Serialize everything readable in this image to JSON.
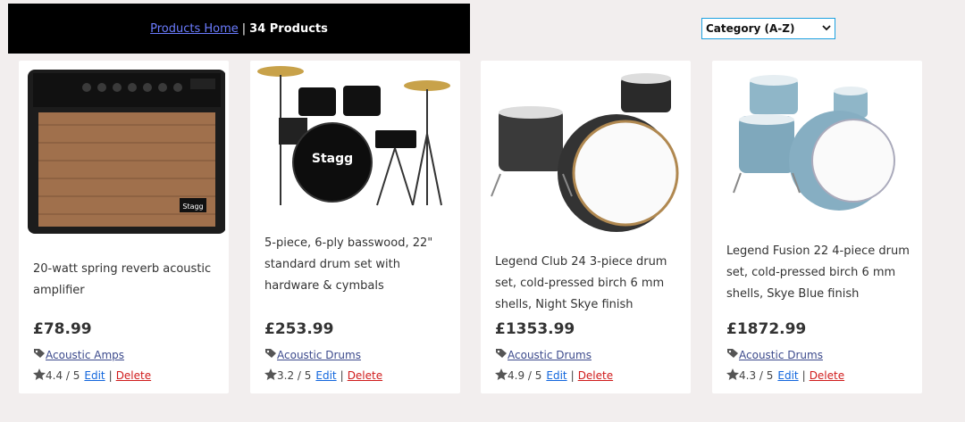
{
  "header": {
    "home_link": "Products Home",
    "separator": "|",
    "count_label": "34 Products"
  },
  "sort": {
    "selected": "Category (A-Z)"
  },
  "products": [
    {
      "description": "20-watt spring reverb acoustic amplifier",
      "price": "£78.99",
      "category": "Acoustic Amps",
      "rating": "4.4 / 5",
      "edit_label": "Edit",
      "delete_label": "Delete",
      "image_text": "Stagg"
    },
    {
      "description": "5-piece, 6-ply basswood, 22\" standard drum set with hardware & cymbals",
      "price": "£253.99",
      "category": "Acoustic Drums",
      "rating": "3.2 / 5",
      "edit_label": "Edit",
      "delete_label": "Delete",
      "image_text": "Stagg"
    },
    {
      "description": "Legend Club 24 3-piece drum set, cold-pressed birch 6 mm shells, Night Skye finish",
      "price": "£1353.99",
      "category": "Acoustic Drums",
      "rating": "4.9 / 5",
      "edit_label": "Edit",
      "delete_label": "Delete"
    },
    {
      "description": "Legend Fusion 22 4-piece drum set, cold-pressed birch 6 mm shells, Skye Blue finish",
      "price": "£1872.99",
      "category": "Acoustic Drums",
      "rating": "4.3 / 5",
      "edit_label": "Edit",
      "delete_label": "Delete"
    }
  ],
  "colors": {
    "page_bg": "#f2eeee",
    "link_blue": "#1166dd",
    "delete_red": "#d01b1b",
    "category_link": "#3c4a8c"
  },
  "icons": [
    "chevron-down-icon",
    "tag-icon",
    "star-icon"
  ]
}
